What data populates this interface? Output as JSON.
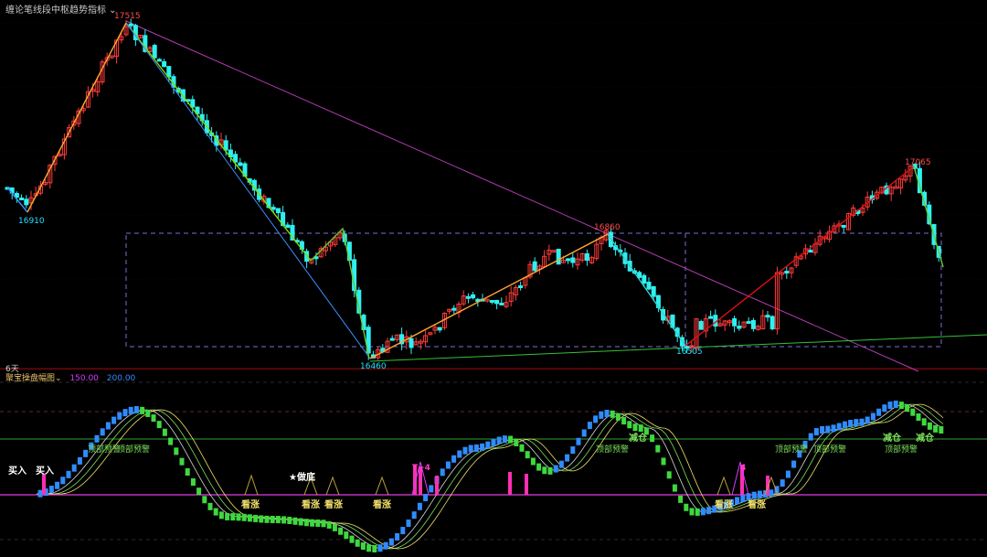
{
  "indicator_title": "缠论笔线段中枢趋势指标",
  "period_label": "6天",
  "sub_indicator": {
    "name": "聚宝操盘幅图",
    "level1": "150.00",
    "level2": "200.00"
  },
  "price_marks": {
    "high1": "17515",
    "low1": "16910",
    "mid_high": "16860",
    "low2": "16460",
    "low3": "16505",
    "high2": "17065"
  },
  "signals": {
    "buy1": "买入",
    "buy2": "买入",
    "bottom": "★做底",
    "rise": "看涨",
    "reduce": "减仓",
    "top_warn": "顶部预警",
    "t4": "T+4",
    "t4_short": "4"
  },
  "colors": {
    "up": "#ff3b3b",
    "down": "#2ff0f0",
    "magenta": "#d63cff",
    "orange": "#ffa733",
    "green": "#3fd83f",
    "blue": "#2f8cff"
  }
}
